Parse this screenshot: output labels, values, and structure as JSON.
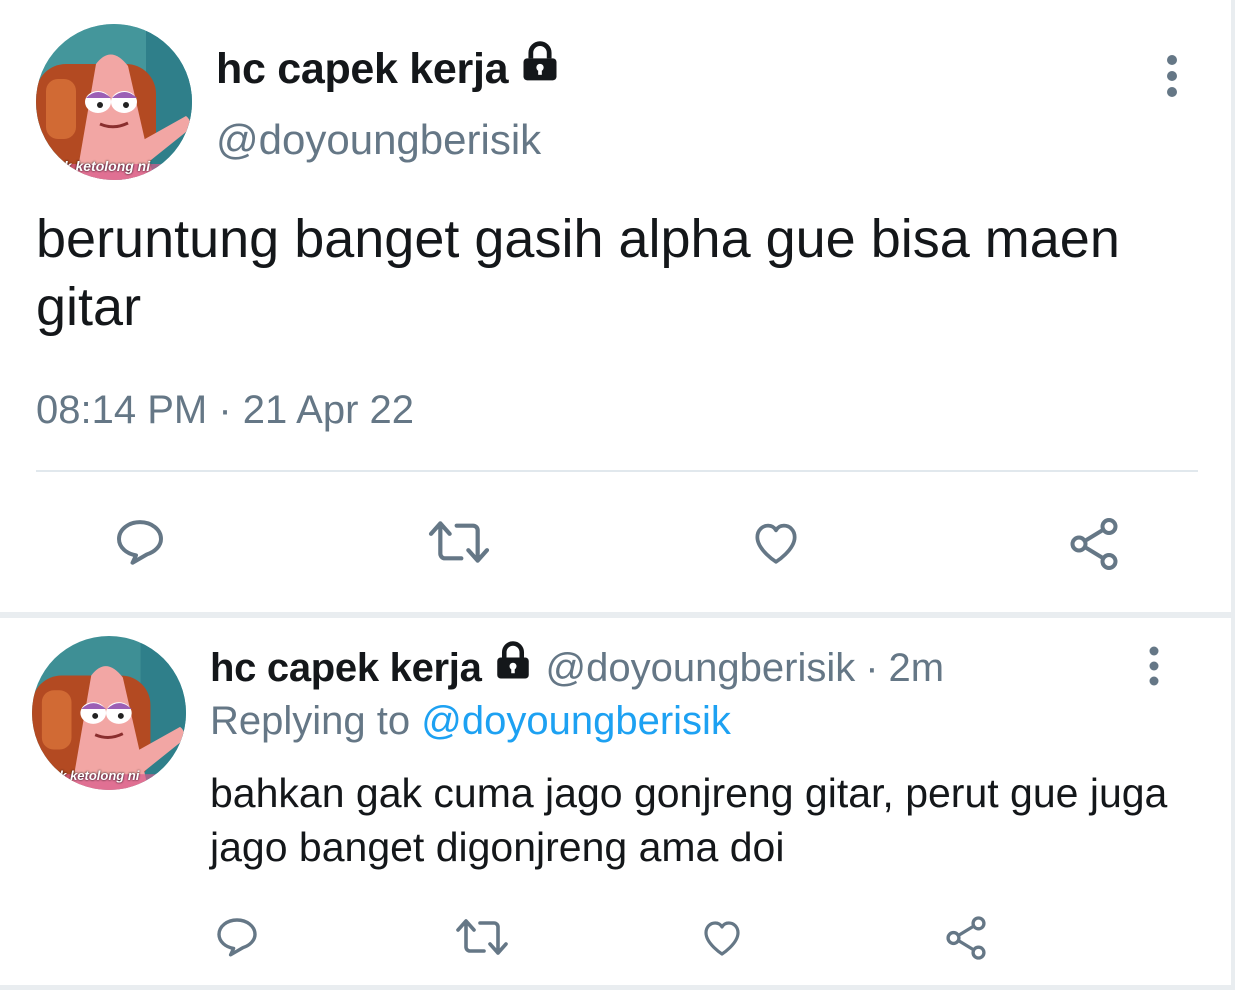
{
  "main_tweet": {
    "display_name": "hc capek kerja",
    "handle": "@doyoungberisik",
    "text": "beruntung banget gasih alpha gue bisa maen gitar",
    "timestamp": "08:14 PM · 21 Apr 22",
    "avatar_caption": "ak ketolong ni",
    "icons": [
      "lock-icon",
      "more-vertical-icon",
      "reply-icon",
      "retweet-icon",
      "like-icon",
      "share-icon"
    ]
  },
  "reply_tweet": {
    "display_name": "hc capek kerja",
    "handle": "@doyoungberisik",
    "separator": "·",
    "time": "2m",
    "replying_to_label": "Replying to",
    "replying_to_handle": "@doyoungberisik",
    "text": "bahkan gak cuma jago gonjreng gitar, perut gue juga jago banget digonjreng ama doi",
    "avatar_caption": "ak ketolong ni"
  },
  "colors": {
    "text": "#14171a",
    "muted": "#657786",
    "link": "#1da1f2",
    "divider": "#e1e8ed"
  }
}
